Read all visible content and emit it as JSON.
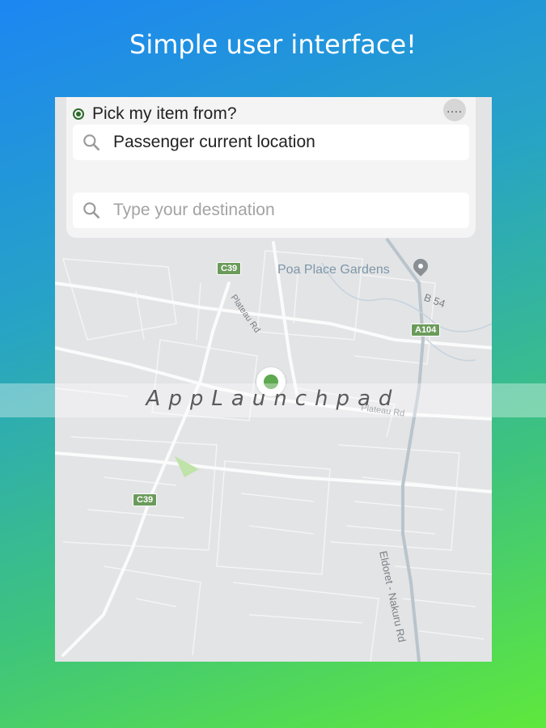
{
  "headline": "Simple user interface!",
  "search": {
    "pick_label": "Pick my item from?",
    "more_label": "....",
    "pickup_value": "Passenger current location",
    "destination_placeholder": "Type your destination"
  },
  "map": {
    "poi": "Poa Place Gardens",
    "roads": {
      "c39_top": "C39",
      "c39_bottom": "C39",
      "a104": "A104",
      "b54": "B 54",
      "plateau_rd": "Plateau Rd",
      "plateau_rd_2": "Plateau Rd",
      "eldoret_nakuru_rd": "Eldoret - Nakuru Rd"
    }
  },
  "watermark": "AppLaunchpad",
  "colors": {
    "radio": "#2c6b2a",
    "pin": "#5ea84f",
    "shield": "#6b9b5b"
  }
}
